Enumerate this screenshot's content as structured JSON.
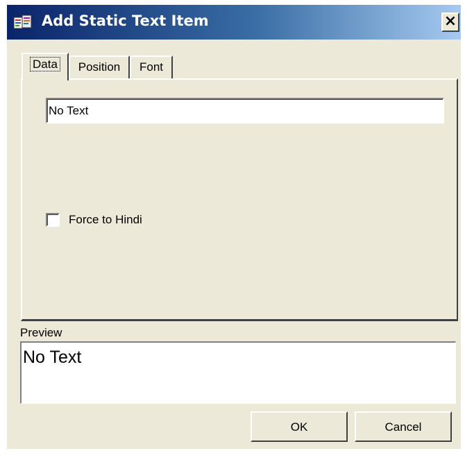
{
  "window": {
    "title": "Add Static Text Item",
    "close_label": "×",
    "icon": "app-document-icon"
  },
  "tabs": [
    {
      "label": "Data",
      "active": true
    },
    {
      "label": "Position",
      "active": false
    },
    {
      "label": "Font",
      "active": false
    }
  ],
  "data_tab": {
    "text_value": "No Text",
    "force_hindi_label": "Force to Hindi",
    "force_hindi_checked": false
  },
  "preview": {
    "label": "Preview",
    "text": "No Text"
  },
  "buttons": {
    "ok_label": "OK",
    "cancel_label": "Cancel"
  },
  "colors": {
    "dialog_face": "#ece9d8",
    "titlebar_start": "#0a246a",
    "titlebar_end": "#a6caf0",
    "title_text": "#ffffff"
  }
}
